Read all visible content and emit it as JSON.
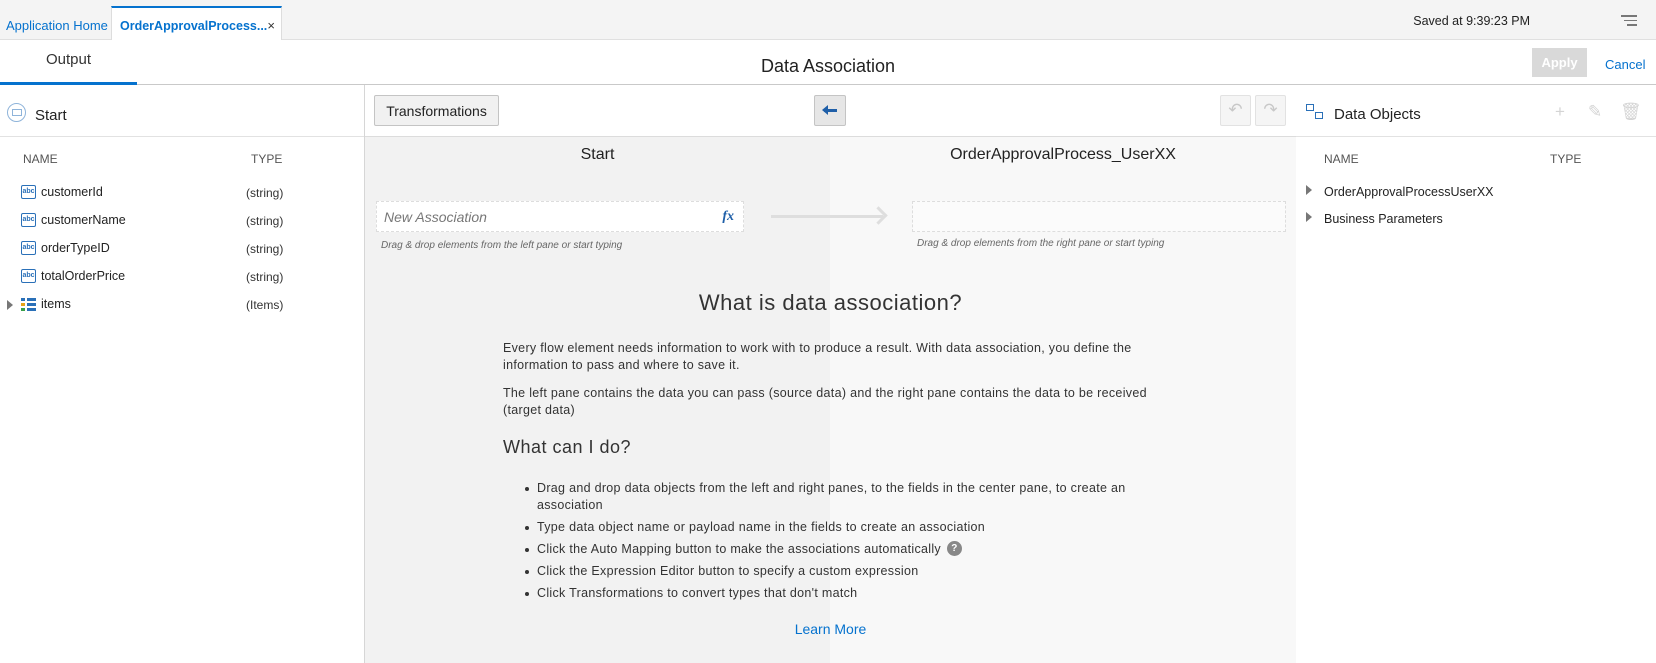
{
  "tabs": {
    "home": "Application Home",
    "active": "OrderApprovalProcess...",
    "close": "×"
  },
  "status": {
    "saved": "Saved at 9:39:23 PM"
  },
  "header": {
    "output_tab": "Output",
    "title": "Data Association",
    "apply": "Apply",
    "cancel": "Cancel"
  },
  "left": {
    "title": "Start",
    "col_name": "NAME",
    "col_type": "TYPE",
    "items": [
      {
        "name": "customerId",
        "type": "(string)",
        "icon": "string-type-icon"
      },
      {
        "name": "customerName",
        "type": "(string)",
        "icon": "string-type-icon"
      },
      {
        "name": "orderTypeID",
        "type": "(string)",
        "icon": "string-type-icon"
      },
      {
        "name": "totalOrderPrice",
        "type": "(string)",
        "icon": "string-type-icon"
      },
      {
        "name": "items",
        "type": "(Items)",
        "icon": "list-type-icon"
      }
    ]
  },
  "center": {
    "transformations": "Transformations",
    "source_title": "Start",
    "target_title": "OrderApprovalProcess_UserXX",
    "new_association_placeholder": "New Association",
    "fx": "fx",
    "source_hint": "Drag & drop elements from the left pane or start typing",
    "target_hint": "Drag & drop elements from the right pane or start typing",
    "help_title": "What is data association?",
    "help_p1": "Every flow element needs information to work with to produce a result. With data association, you define the information to pass and where to save it.",
    "help_p2": "The left pane contains the data you can pass (source data) and the right pane contains the data to be received (target data)",
    "help_h2": "What can I do?",
    "help_items": [
      "Drag and drop data objects from the left and right panes, to the fields in the center pane, to create an association",
      "Type data object name or payload name in the fields to create an association",
      "Click the Auto Mapping button to make the associations automatically",
      "Click the Expression Editor button to specify a custom expression",
      "Click Transformations to convert types that don't match"
    ],
    "help_q": "?",
    "learn_more": "Learn More"
  },
  "right": {
    "title": "Data Objects",
    "col_name": "NAME",
    "col_type": "TYPE",
    "items": [
      {
        "name": "OrderApprovalProcessUserXX"
      },
      {
        "name": "Business Parameters"
      }
    ]
  },
  "colors": {
    "accent": "#0572ce",
    "icon_blue": "#2a70b8",
    "center_bg": "#f2f2f2"
  }
}
